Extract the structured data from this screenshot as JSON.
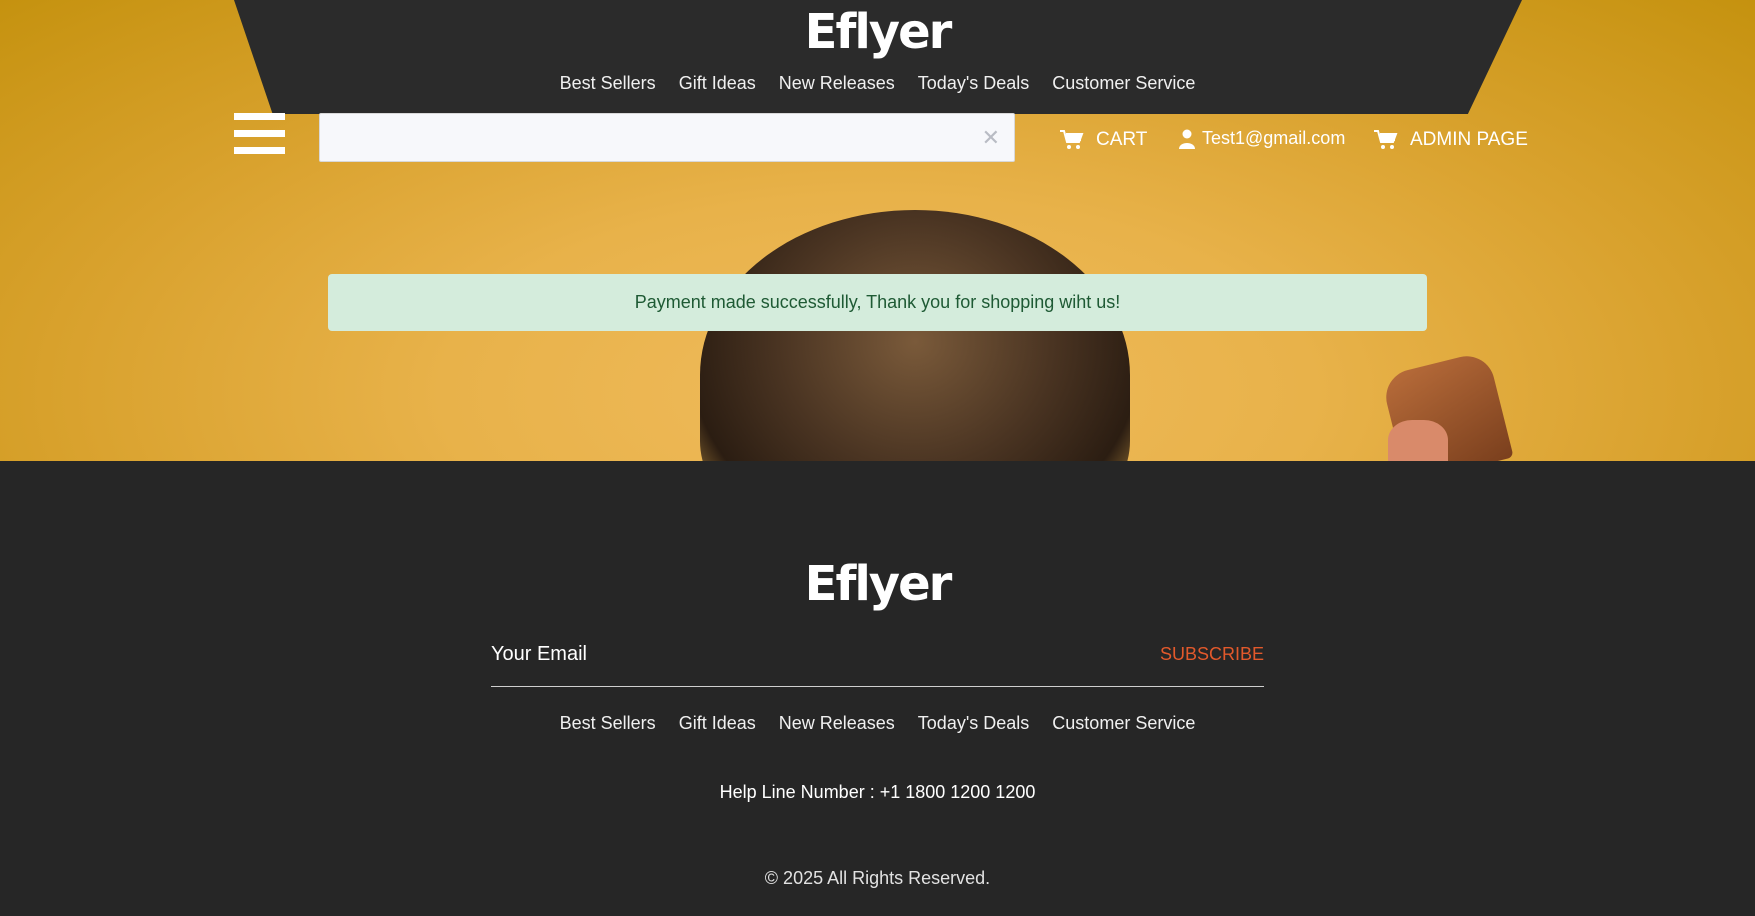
{
  "brand": {
    "name": "Eflyer"
  },
  "header": {
    "nav": [
      "Best Sellers",
      "Gift Ideas",
      "New Releases",
      "Today's Deals",
      "Customer Service"
    ],
    "search": {
      "value": "",
      "placeholder": ""
    },
    "cart_label": "CART",
    "user_email": "Test1@gmail.com",
    "admin_label": "ADMIN PAGE",
    "icons": [
      "menu-icon",
      "close-icon",
      "cart-icon",
      "user-icon"
    ]
  },
  "alert": {
    "message": "Payment made successfully, Thank you for shopping wiht us!",
    "bg_color": "#d4ecdc",
    "text_color": "#1e5a34"
  },
  "footer": {
    "email_placeholder": "Your Email",
    "subscribe_label": "SUBSCRIBE",
    "nav": [
      "Best Sellers",
      "Gift Ideas",
      "New Releases",
      "Today's Deals",
      "Customer Service"
    ],
    "helpline": "Help Line Number : +1 1800 1200 1200",
    "copyright": "© 2025 All Rights Reserved."
  },
  "colors": {
    "dark": "#262626",
    "accent": "#e2592b",
    "hero": "#e8b24a"
  }
}
